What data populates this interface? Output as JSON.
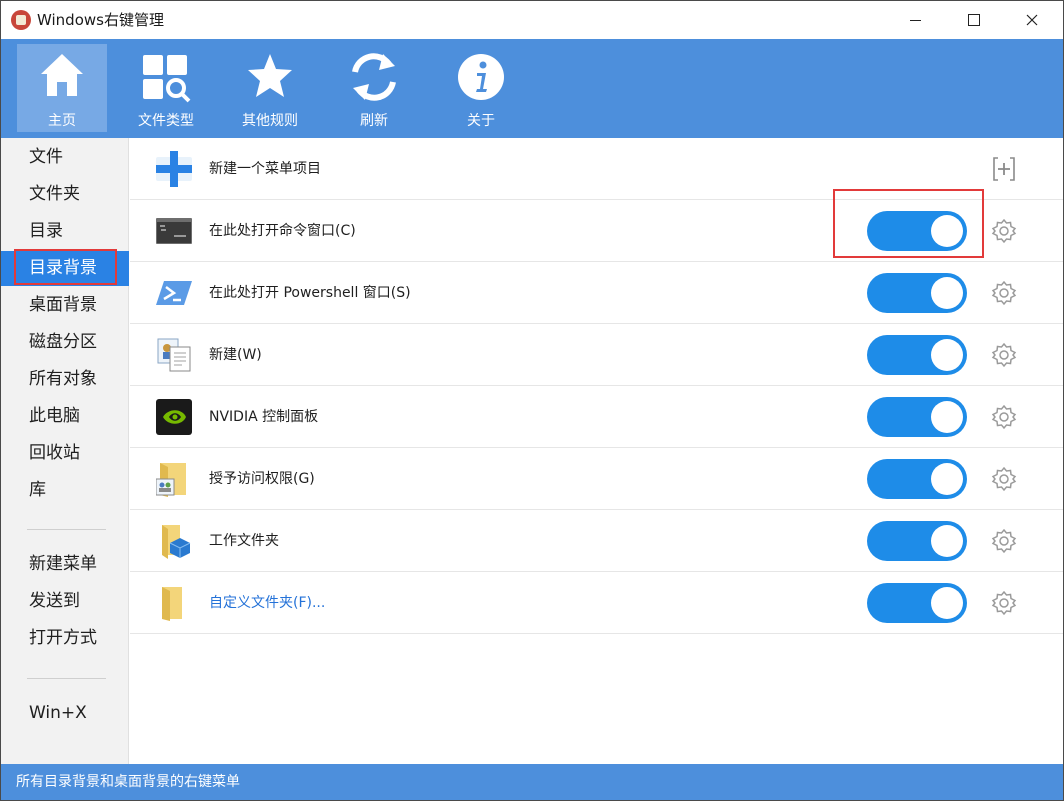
{
  "window": {
    "title": "Windows右键管理"
  },
  "toolbar": {
    "items": [
      {
        "label": "主页",
        "icon": "home-icon",
        "active": true
      },
      {
        "label": "文件类型",
        "icon": "file-type-search-icon"
      },
      {
        "label": "其他规则",
        "icon": "star-icon"
      },
      {
        "label": "刷新",
        "icon": "refresh-icon"
      },
      {
        "label": "关于",
        "icon": "info-icon"
      }
    ]
  },
  "sidebar": {
    "items": [
      {
        "label": "文件"
      },
      {
        "label": "文件夹"
      },
      {
        "label": "目录"
      },
      {
        "label": "目录背景",
        "selected": true
      },
      {
        "label": "桌面背景"
      },
      {
        "label": "磁盘分区"
      },
      {
        "label": "所有对象"
      },
      {
        "label": "此电脑"
      },
      {
        "label": "回收站"
      },
      {
        "label": "库"
      },
      {
        "label": "新建菜单"
      },
      {
        "label": "发送到"
      },
      {
        "label": "打开方式"
      },
      {
        "label": "Win+X"
      }
    ]
  },
  "main": {
    "rows": [
      {
        "label": "新建一个菜单项目",
        "icon": "add-item-icon",
        "action": "add"
      },
      {
        "label": "在此处打开命令窗口(C)",
        "icon": "cmd-icon",
        "enabled": true
      },
      {
        "label": "在此处打开 Powershell 窗口(S)",
        "icon": "powershell-icon",
        "enabled": true
      },
      {
        "label": "新建(W)",
        "icon": "new-icon",
        "enabled": true
      },
      {
        "label": "NVIDIA 控制面板",
        "icon": "nvidia-icon",
        "enabled": true
      },
      {
        "label": "授予访问权限(G)",
        "icon": "share-folder-icon",
        "enabled": true
      },
      {
        "label": "工作文件夹",
        "icon": "work-folder-icon",
        "enabled": true
      },
      {
        "label": "自定义文件夹(F)...",
        "icon": "folder-icon",
        "enabled": true,
        "link": true
      }
    ]
  },
  "statusbar": {
    "text": "所有目录背景和桌面背景的右键菜单"
  },
  "colors": {
    "accent": "#4d8fdc",
    "toggle_on": "#1e8ce8",
    "highlight": "#e23a3a",
    "sidebar_selected": "#2a82e4"
  }
}
